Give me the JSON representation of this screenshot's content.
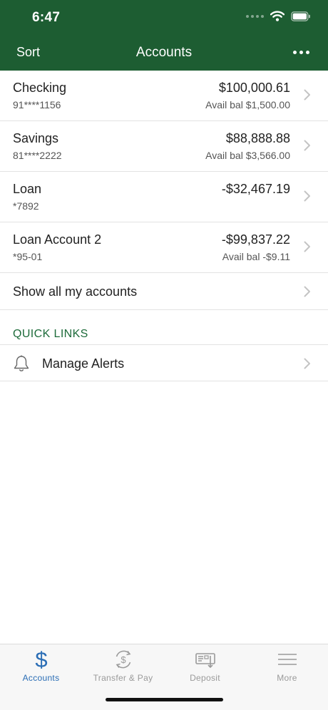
{
  "status_bar": {
    "time": "6:47"
  },
  "header": {
    "sort_label": "Sort",
    "title": "Accounts"
  },
  "accounts": [
    {
      "name": "Checking",
      "number": "91****1156",
      "balance": "$100,000.61",
      "avail": "Avail bal $1,500.00"
    },
    {
      "name": "Savings",
      "number": "81****2222",
      "balance": "$88,888.88",
      "avail": "Avail bal $3,566.00"
    },
    {
      "name": "Loan",
      "number": "*7892",
      "balance": "-$32,467.19",
      "avail": ""
    },
    {
      "name": "Loan Account 2",
      "number": "*95-01",
      "balance": "-$99,837.22",
      "avail": "Avail bal -$9.11"
    }
  ],
  "show_all_label": "Show all my accounts",
  "quick_links": {
    "title": "QUICK LINKS",
    "items": [
      {
        "label": "Manage Alerts",
        "icon": "bell-icon"
      }
    ]
  },
  "tabs": [
    {
      "label": "Accounts",
      "icon": "dollar-icon",
      "active": true
    },
    {
      "label": "Transfer & Pay",
      "icon": "transfer-pay-icon",
      "active": false
    },
    {
      "label": "Deposit",
      "icon": "deposit-check-icon",
      "active": false
    },
    {
      "label": "More",
      "icon": "hamburger-menu-icon",
      "active": false
    }
  ],
  "colors": {
    "header_green": "#1d5d32",
    "quick_links_green": "#1d6b3a",
    "active_tab_blue": "#2a6db5",
    "inactive_tab_gray": "#9a9a9a"
  }
}
